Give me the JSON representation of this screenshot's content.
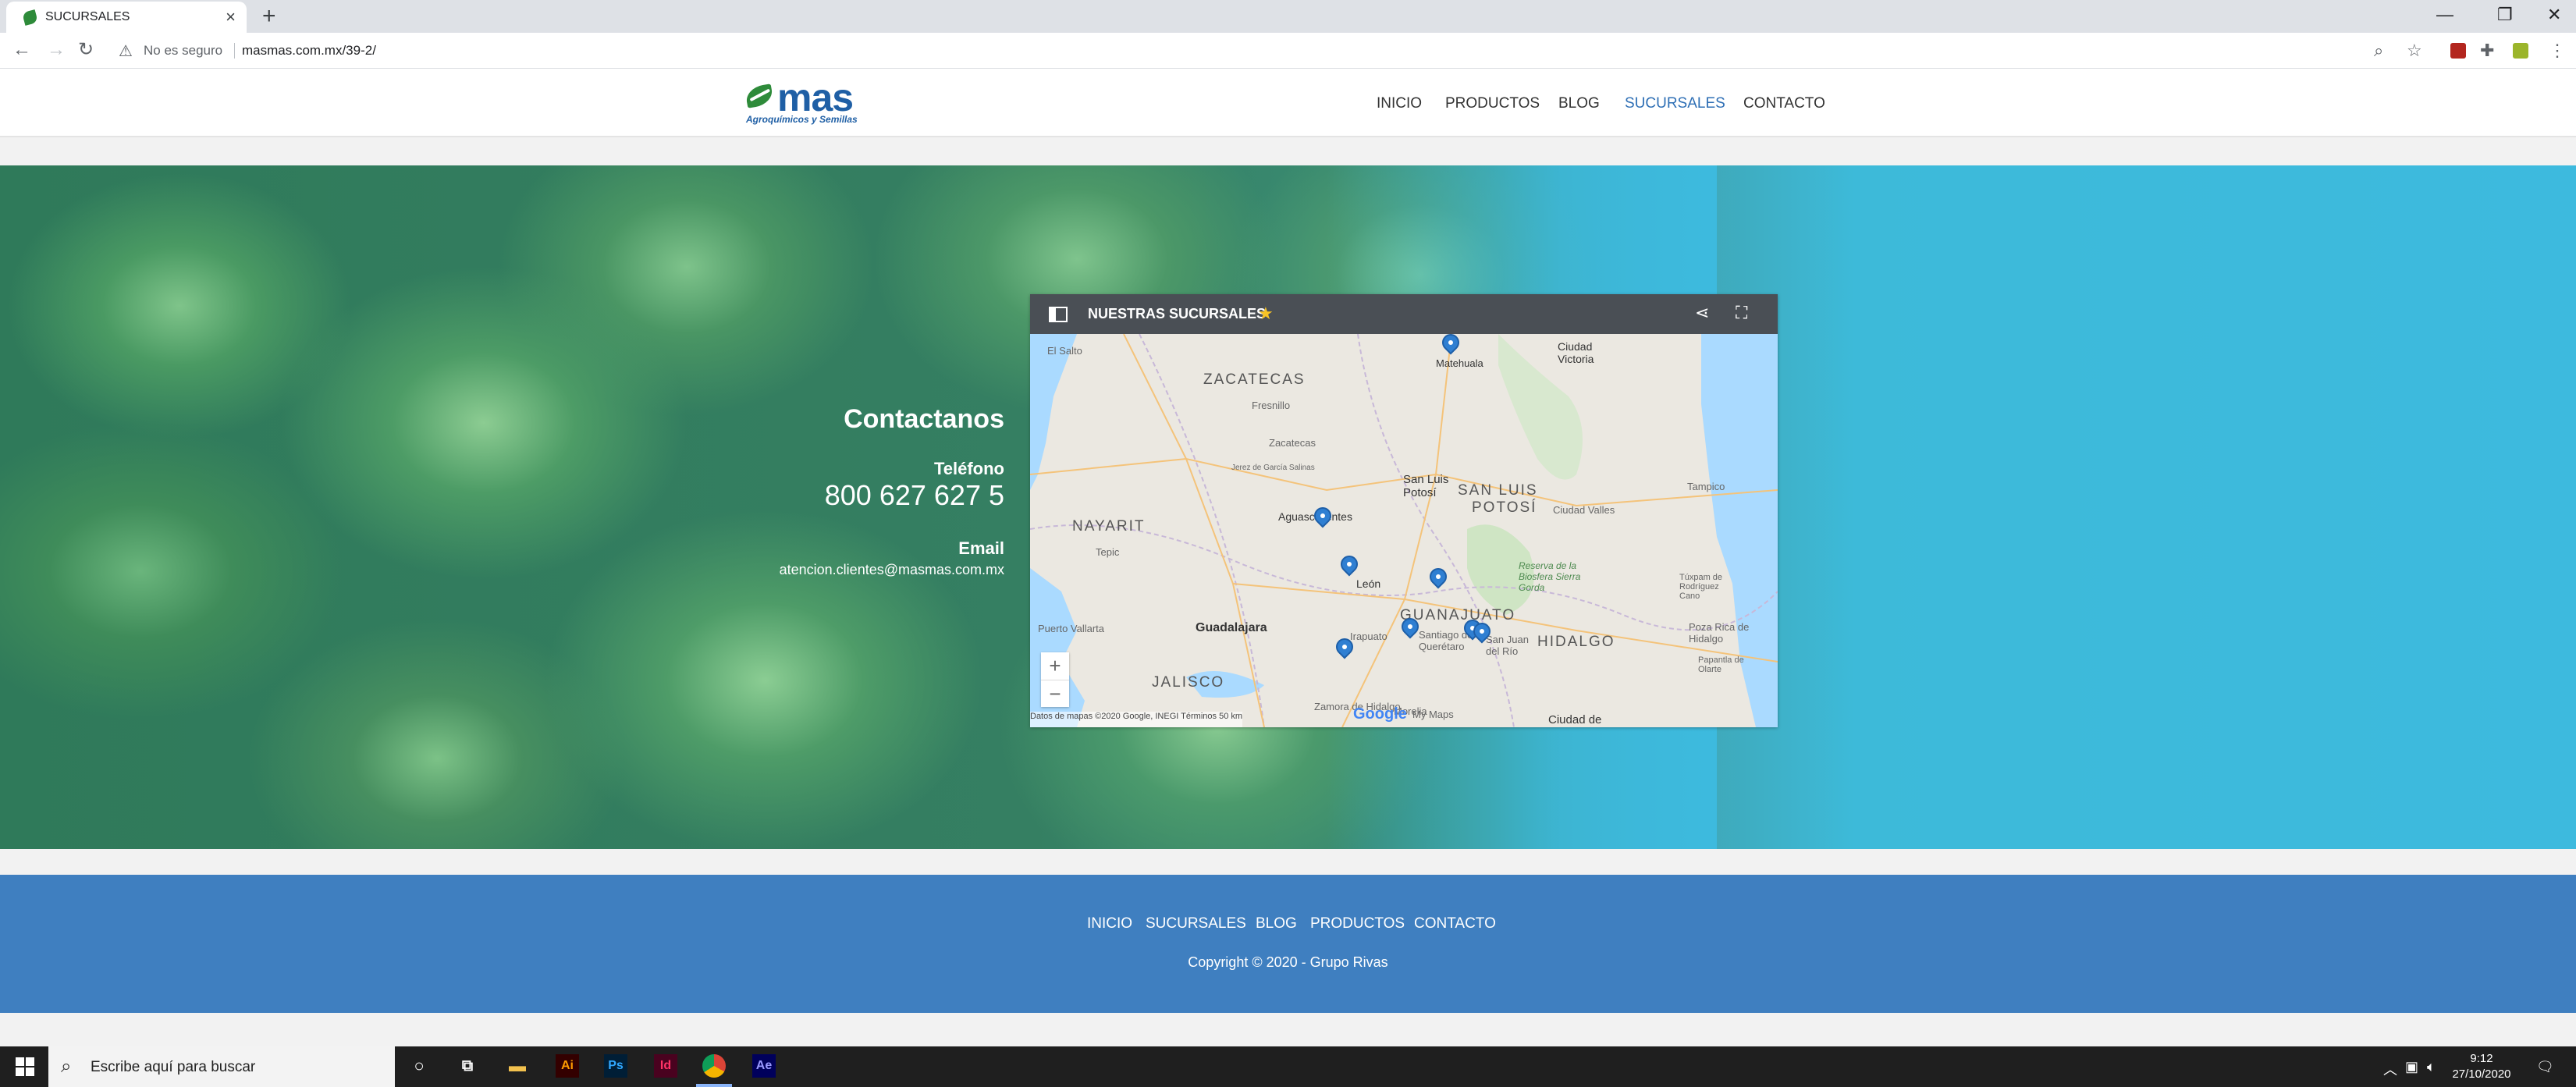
{
  "browser": {
    "tab_title": "SUCURSALES",
    "tab_close": "×",
    "new_tab": "+",
    "security_label": "No es seguro",
    "url": "masmas.com.mx/39-2/",
    "window_controls": [
      "—",
      "❐",
      "✕"
    ]
  },
  "site": {
    "logo_word": "mas",
    "logo_tagline": "Agroquímicos y Semillas",
    "nav": [
      "INICIO",
      "PRODUCTOS",
      "BLOG",
      "SUCURSALES",
      "CONTACTO"
    ],
    "active_nav": "SUCURSALES"
  },
  "contact": {
    "title": "Contactanos",
    "phone_label": "Teléfono",
    "phone": "800 627 627 5",
    "email_label": "Email",
    "email": "atencion.clientes@masmas.com.mx"
  },
  "map": {
    "title": "NUESTRAS SUCURSALES",
    "labels": {
      "zacatecas_state": "ZACATECAS",
      "nayarit": "NAYARIT",
      "san_luis_state": "SAN LUIS",
      "potosi_state": "POTOSÍ",
      "guanajuato": "GUANAJUATO",
      "jalisco": "JALISCO",
      "hidalgo": "HIDALGO",
      "matehuala": "Matehuala",
      "ciudad_victoria": "Ciudad Victoria",
      "fresnillo": "Fresnillo",
      "zacatecas_city": "Zacatecas",
      "san_luis_potosi": "San Luis Potosí",
      "tampico": "Tampico",
      "aguascalientes": "Aguascalientes",
      "ciudad_valles": "Ciudad Valles",
      "tepic": "Tepic",
      "leon": "León",
      "puerto_vallarta": "Puerto Vallarta",
      "guadalajara": "Guadalajara",
      "irapuato": "Irapuato",
      "santiago_queretaro": "Santiago de Querétaro",
      "san_juan_del_rio": "San Juan del Río",
      "poza_rica": "Poza Rica de Hidalgo",
      "morelia": "Morelia",
      "zamora": "Zamora de Hidalgo",
      "ciudad_de_mexico": "Ciudad de",
      "sierra_gorda": "Reserva de la Biosfera Sierra Gorda",
      "el_salto": "El Salto",
      "tuxpan": "Túxpam de Rodríguez Cano",
      "papantla": "Papantla de Olarte",
      "jerez": "Jerez de García Salinas"
    },
    "zoom_in": "+",
    "zoom_out": "−",
    "google": "Google",
    "my_maps": "My Maps",
    "attribution": "Datos de mapas ©2020 Google, INEGI  Términos  50 km"
  },
  "footer": {
    "links": [
      "INICIO",
      "SUCURSALES",
      "BLOG",
      "PRODUCTOS",
      "CONTACTO"
    ],
    "copyright": "Copyright © 2020 - Grupo Rivas"
  },
  "taskbar": {
    "search_placeholder": "Escribe aquí para buscar",
    "apps": [
      "Ai",
      "Ps",
      "Id",
      "Ae"
    ],
    "time": "9:12",
    "date": "27/10/2020"
  },
  "colors": {
    "brand_blue": "#1f5fa5",
    "nav_active": "#2e6fb5",
    "footer_blue": "#3f7fc0",
    "hero_cyan": "#3dbade",
    "map_header": "#4a4f55",
    "pin_blue": "#2f7fd2"
  }
}
